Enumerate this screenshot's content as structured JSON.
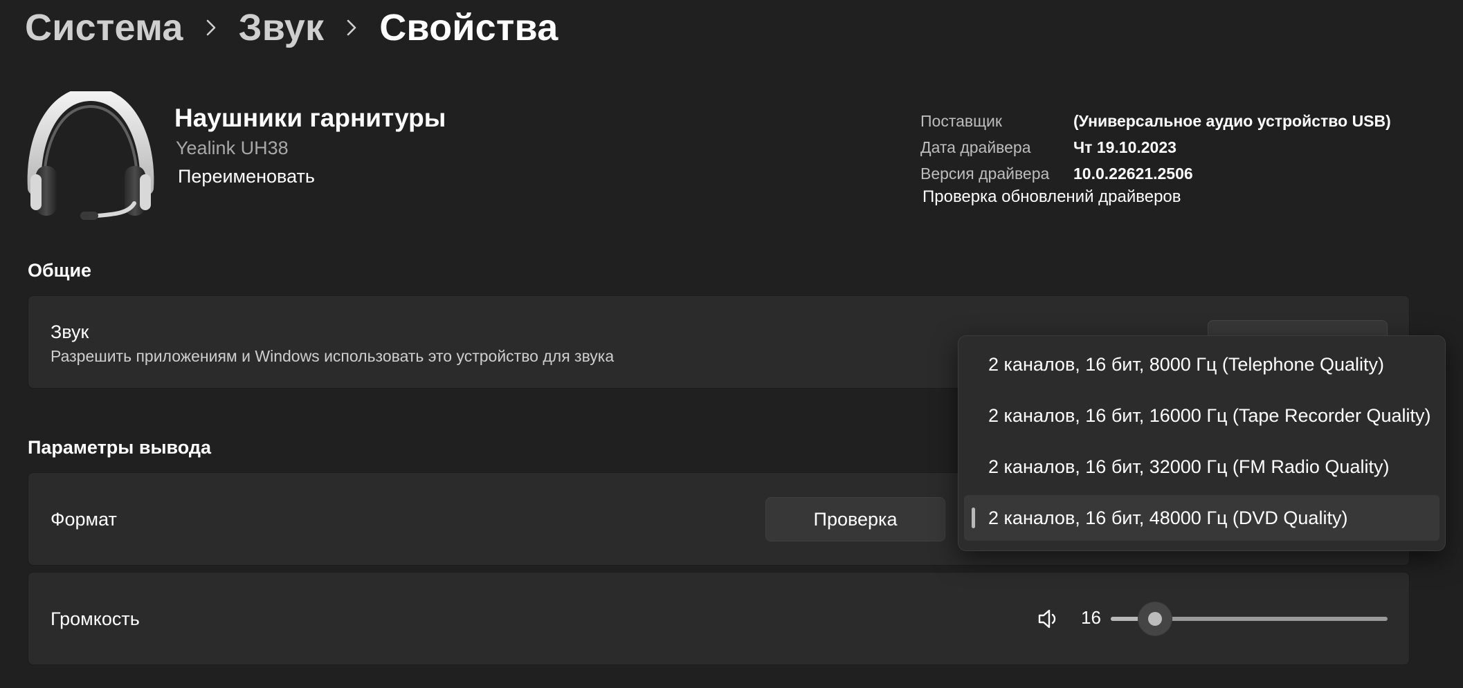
{
  "breadcrumb": {
    "items": [
      "Система",
      "Звук",
      "Свойства"
    ],
    "separator_icon": "chevron-right-icon"
  },
  "device": {
    "icon": "headset-icon",
    "name": "Наушники гарнитуры",
    "model": "Yealink UH38",
    "rename_label": "Переименовать"
  },
  "driver": {
    "rows": [
      {
        "label": "Поставщик",
        "value": "(Универсальное аудио устройство USB)"
      },
      {
        "label": "Дата драйвера",
        "value": "Чт 19.10.2023"
      },
      {
        "label": "Версия драйвера",
        "value": "10.0.22621.2506"
      }
    ],
    "update_link": "Проверка обновлений драйверов"
  },
  "general": {
    "heading": "Общие",
    "sound": {
      "title": "Звук",
      "subtitle": "Разрешить приложениям и Windows использовать это устройство для звука"
    }
  },
  "output": {
    "heading": "Параметры вывода",
    "format": {
      "title": "Формат",
      "test_button": "Проверка",
      "options": [
        "2 каналов, 16 бит, 8000 Гц (Telephone Quality)",
        "2 каналов, 16 бит, 16000 Гц (Tape Recorder Quality)",
        "2 каналов, 16 бит, 32000 Гц (FM Radio Quality)",
        "2 каналов, 16 бит, 48000 Гц (DVD Quality)"
      ],
      "selected_index": 3
    },
    "volume": {
      "title": "Громкость",
      "icon": "speaker-icon",
      "value": "16",
      "level": 0.16
    }
  },
  "colors": {
    "background": "#202020",
    "card": "#2b2b2b",
    "flyout": "#2c2c2c",
    "text": "#ffffff",
    "secondary_text": "#bdbdbd"
  }
}
